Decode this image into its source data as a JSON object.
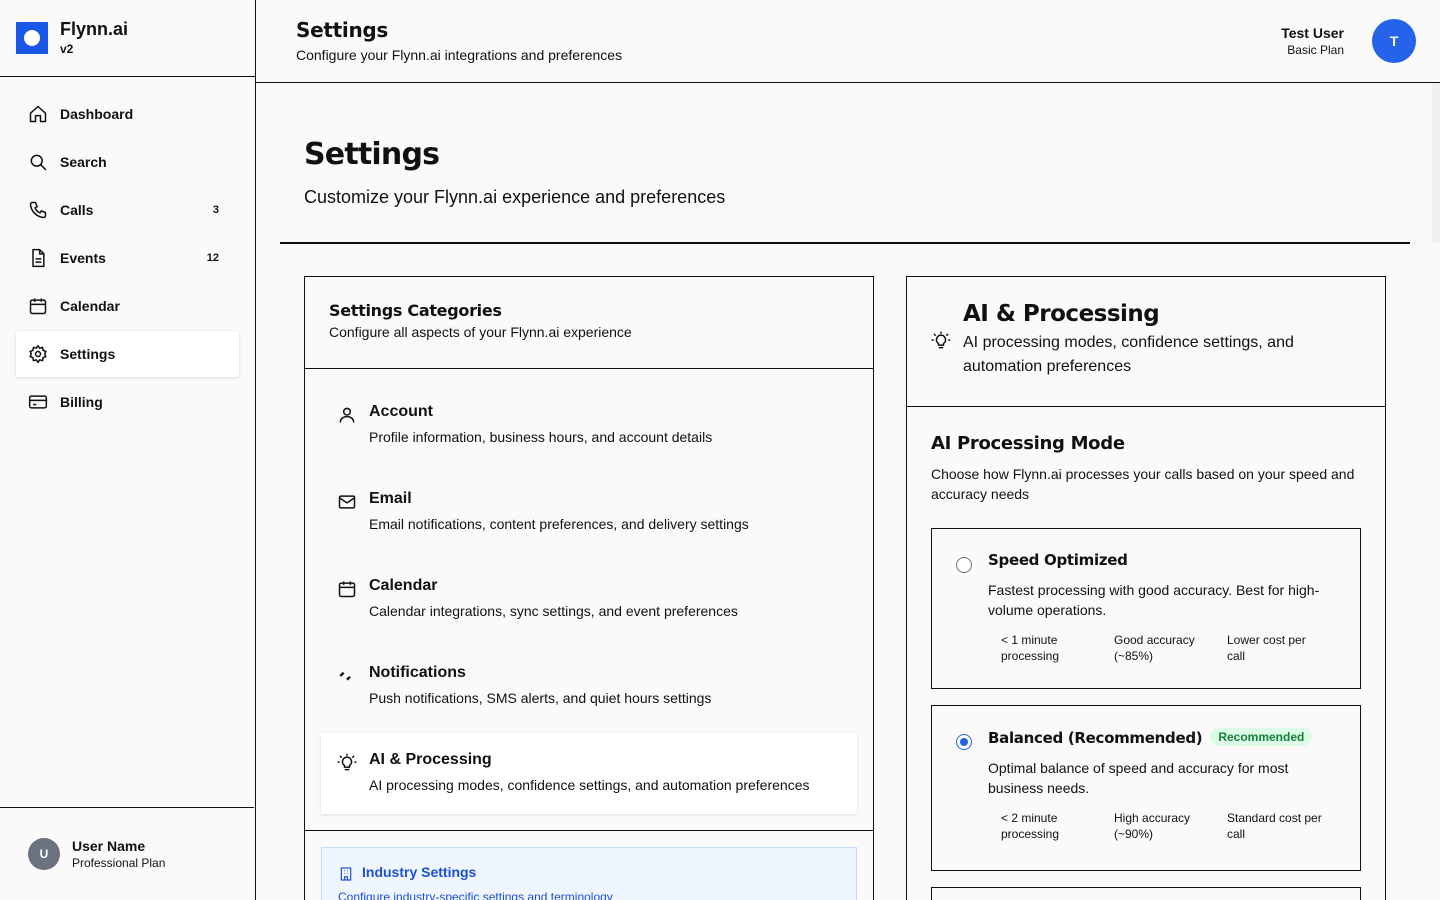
{
  "app": {
    "name": "Flynn.ai",
    "version": "v2"
  },
  "sidebar": {
    "items": [
      {
        "label": "Dashboard",
        "icon": "home-icon",
        "badge": ""
      },
      {
        "label": "Search",
        "icon": "search-icon",
        "badge": ""
      },
      {
        "label": "Calls",
        "icon": "phone-icon",
        "badge": "3"
      },
      {
        "label": "Events",
        "icon": "document-icon",
        "badge": "12"
      },
      {
        "label": "Calendar",
        "icon": "calendar-icon",
        "badge": ""
      },
      {
        "label": "Settings",
        "icon": "gear-icon",
        "badge": "",
        "active": true
      },
      {
        "label": "Billing",
        "icon": "credit-card-icon",
        "badge": ""
      }
    ],
    "user": {
      "initial": "U",
      "name": "User Name",
      "plan": "Professional Plan"
    }
  },
  "header": {
    "title": "Settings",
    "subtitle": "Configure your Flynn.ai integrations and preferences",
    "user": {
      "name": "Test User",
      "plan": "Basic Plan",
      "initial": "T"
    }
  },
  "page": {
    "title": "Settings",
    "subtitle": "Customize your Flynn.ai experience and preferences"
  },
  "categories": {
    "title": "Settings Categories",
    "subtitle": "Configure all aspects of your Flynn.ai experience",
    "items": [
      {
        "title": "Account",
        "desc": "Profile information, business hours, and account details",
        "icon": "user-icon"
      },
      {
        "title": "Email",
        "desc": "Email notifications, content preferences, and delivery settings",
        "icon": "mail-icon"
      },
      {
        "title": "Calendar",
        "desc": "Calendar integrations, sync settings, and event preferences",
        "icon": "calendar-icon"
      },
      {
        "title": "Notifications",
        "desc": "Push notifications, SMS alerts, and quiet hours settings",
        "icon": "bell-icon"
      },
      {
        "title": "AI & Processing",
        "desc": "AI processing modes, confidence settings, and automation preferences",
        "icon": "lightbulb-icon",
        "active": true
      }
    ],
    "industry": {
      "title": "Industry Settings",
      "desc": "Configure industry-specific settings and terminology",
      "icon": "building-icon"
    }
  },
  "ai_panel": {
    "title": "AI & Processing",
    "subtitle": "AI processing modes, confidence settings, and automation preferences",
    "section_title": "AI Processing Mode",
    "section_subtitle": "Choose how Flynn.ai processes your calls based on your speed and accuracy needs",
    "modes": [
      {
        "title": "Speed Optimized",
        "desc": "Fastest processing with good accuracy. Best for high-volume operations.",
        "selected": false,
        "badge": "",
        "stats": [
          "< 1 minute processing",
          "Good accuracy (~85%)",
          "Lower cost per call"
        ]
      },
      {
        "title": "Balanced (Recommended)",
        "desc": "Optimal balance of speed and accuracy for most business needs.",
        "selected": true,
        "badge": "Recommended",
        "stats": [
          "< 2 minute processing",
          "High accuracy (~90%)",
          "Standard cost per call"
        ]
      }
    ]
  },
  "colors": {
    "accent": "#2563eb",
    "logo": "#1a56e8",
    "badge_bg": "#dcfce7",
    "badge_text": "#15803d",
    "info_bg": "#eff6ff"
  }
}
